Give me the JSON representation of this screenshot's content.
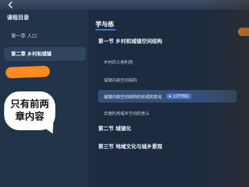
{
  "header": {
    "back_icon": "chevron-left-icon"
  },
  "sidebar": {
    "title": "课程目录",
    "items": [
      {
        "label": "第一章  人口",
        "active": false
      },
      {
        "label": "第二章  乡村和城镇",
        "active": true
      }
    ]
  },
  "annotation": {
    "text": "只有前两章内容"
  },
  "main": {
    "title": "学与练",
    "sections": [
      {
        "label": "第一节  乡村和城镇空间结构",
        "lessons": [
          {
            "label": "乡村的土地利用"
          },
          {
            "label": "城镇内部空间结构"
          },
          {
            "label": "城镇内部空间结构的形成和变化",
            "badge": "上次学到这"
          },
          {
            "label": "合理利用城乡空间的意义"
          }
        ]
      },
      {
        "label": "第二节  城镇化"
      },
      {
        "label": "第三节  地域文化与城乡景观"
      }
    ]
  },
  "colors": {
    "accent": "#4c7bd9",
    "highlight": "#ff8a1f",
    "background": "#1b2a40"
  }
}
